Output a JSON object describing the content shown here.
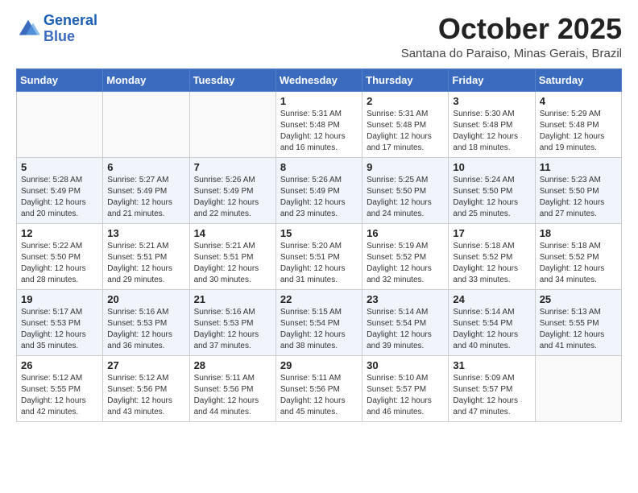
{
  "logo": {
    "line1": "General",
    "line2": "Blue"
  },
  "title": "October 2025",
  "subtitle": "Santana do Paraiso, Minas Gerais, Brazil",
  "days_of_week": [
    "Sunday",
    "Monday",
    "Tuesday",
    "Wednesday",
    "Thursday",
    "Friday",
    "Saturday"
  ],
  "weeks": [
    [
      {
        "day": "",
        "info": ""
      },
      {
        "day": "",
        "info": ""
      },
      {
        "day": "",
        "info": ""
      },
      {
        "day": "1",
        "info": "Sunrise: 5:31 AM\nSunset: 5:48 PM\nDaylight: 12 hours\nand 16 minutes."
      },
      {
        "day": "2",
        "info": "Sunrise: 5:31 AM\nSunset: 5:48 PM\nDaylight: 12 hours\nand 17 minutes."
      },
      {
        "day": "3",
        "info": "Sunrise: 5:30 AM\nSunset: 5:48 PM\nDaylight: 12 hours\nand 18 minutes."
      },
      {
        "day": "4",
        "info": "Sunrise: 5:29 AM\nSunset: 5:48 PM\nDaylight: 12 hours\nand 19 minutes."
      }
    ],
    [
      {
        "day": "5",
        "info": "Sunrise: 5:28 AM\nSunset: 5:49 PM\nDaylight: 12 hours\nand 20 minutes."
      },
      {
        "day": "6",
        "info": "Sunrise: 5:27 AM\nSunset: 5:49 PM\nDaylight: 12 hours\nand 21 minutes."
      },
      {
        "day": "7",
        "info": "Sunrise: 5:26 AM\nSunset: 5:49 PM\nDaylight: 12 hours\nand 22 minutes."
      },
      {
        "day": "8",
        "info": "Sunrise: 5:26 AM\nSunset: 5:49 PM\nDaylight: 12 hours\nand 23 minutes."
      },
      {
        "day": "9",
        "info": "Sunrise: 5:25 AM\nSunset: 5:50 PM\nDaylight: 12 hours\nand 24 minutes."
      },
      {
        "day": "10",
        "info": "Sunrise: 5:24 AM\nSunset: 5:50 PM\nDaylight: 12 hours\nand 25 minutes."
      },
      {
        "day": "11",
        "info": "Sunrise: 5:23 AM\nSunset: 5:50 PM\nDaylight: 12 hours\nand 27 minutes."
      }
    ],
    [
      {
        "day": "12",
        "info": "Sunrise: 5:22 AM\nSunset: 5:50 PM\nDaylight: 12 hours\nand 28 minutes."
      },
      {
        "day": "13",
        "info": "Sunrise: 5:21 AM\nSunset: 5:51 PM\nDaylight: 12 hours\nand 29 minutes."
      },
      {
        "day": "14",
        "info": "Sunrise: 5:21 AM\nSunset: 5:51 PM\nDaylight: 12 hours\nand 30 minutes."
      },
      {
        "day": "15",
        "info": "Sunrise: 5:20 AM\nSunset: 5:51 PM\nDaylight: 12 hours\nand 31 minutes."
      },
      {
        "day": "16",
        "info": "Sunrise: 5:19 AM\nSunset: 5:52 PM\nDaylight: 12 hours\nand 32 minutes."
      },
      {
        "day": "17",
        "info": "Sunrise: 5:18 AM\nSunset: 5:52 PM\nDaylight: 12 hours\nand 33 minutes."
      },
      {
        "day": "18",
        "info": "Sunrise: 5:18 AM\nSunset: 5:52 PM\nDaylight: 12 hours\nand 34 minutes."
      }
    ],
    [
      {
        "day": "19",
        "info": "Sunrise: 5:17 AM\nSunset: 5:53 PM\nDaylight: 12 hours\nand 35 minutes."
      },
      {
        "day": "20",
        "info": "Sunrise: 5:16 AM\nSunset: 5:53 PM\nDaylight: 12 hours\nand 36 minutes."
      },
      {
        "day": "21",
        "info": "Sunrise: 5:16 AM\nSunset: 5:53 PM\nDaylight: 12 hours\nand 37 minutes."
      },
      {
        "day": "22",
        "info": "Sunrise: 5:15 AM\nSunset: 5:54 PM\nDaylight: 12 hours\nand 38 minutes."
      },
      {
        "day": "23",
        "info": "Sunrise: 5:14 AM\nSunset: 5:54 PM\nDaylight: 12 hours\nand 39 minutes."
      },
      {
        "day": "24",
        "info": "Sunrise: 5:14 AM\nSunset: 5:54 PM\nDaylight: 12 hours\nand 40 minutes."
      },
      {
        "day": "25",
        "info": "Sunrise: 5:13 AM\nSunset: 5:55 PM\nDaylight: 12 hours\nand 41 minutes."
      }
    ],
    [
      {
        "day": "26",
        "info": "Sunrise: 5:12 AM\nSunset: 5:55 PM\nDaylight: 12 hours\nand 42 minutes."
      },
      {
        "day": "27",
        "info": "Sunrise: 5:12 AM\nSunset: 5:56 PM\nDaylight: 12 hours\nand 43 minutes."
      },
      {
        "day": "28",
        "info": "Sunrise: 5:11 AM\nSunset: 5:56 PM\nDaylight: 12 hours\nand 44 minutes."
      },
      {
        "day": "29",
        "info": "Sunrise: 5:11 AM\nSunset: 5:56 PM\nDaylight: 12 hours\nand 45 minutes."
      },
      {
        "day": "30",
        "info": "Sunrise: 5:10 AM\nSunset: 5:57 PM\nDaylight: 12 hours\nand 46 minutes."
      },
      {
        "day": "31",
        "info": "Sunrise: 5:09 AM\nSunset: 5:57 PM\nDaylight: 12 hours\nand 47 minutes."
      },
      {
        "day": "",
        "info": ""
      }
    ]
  ]
}
